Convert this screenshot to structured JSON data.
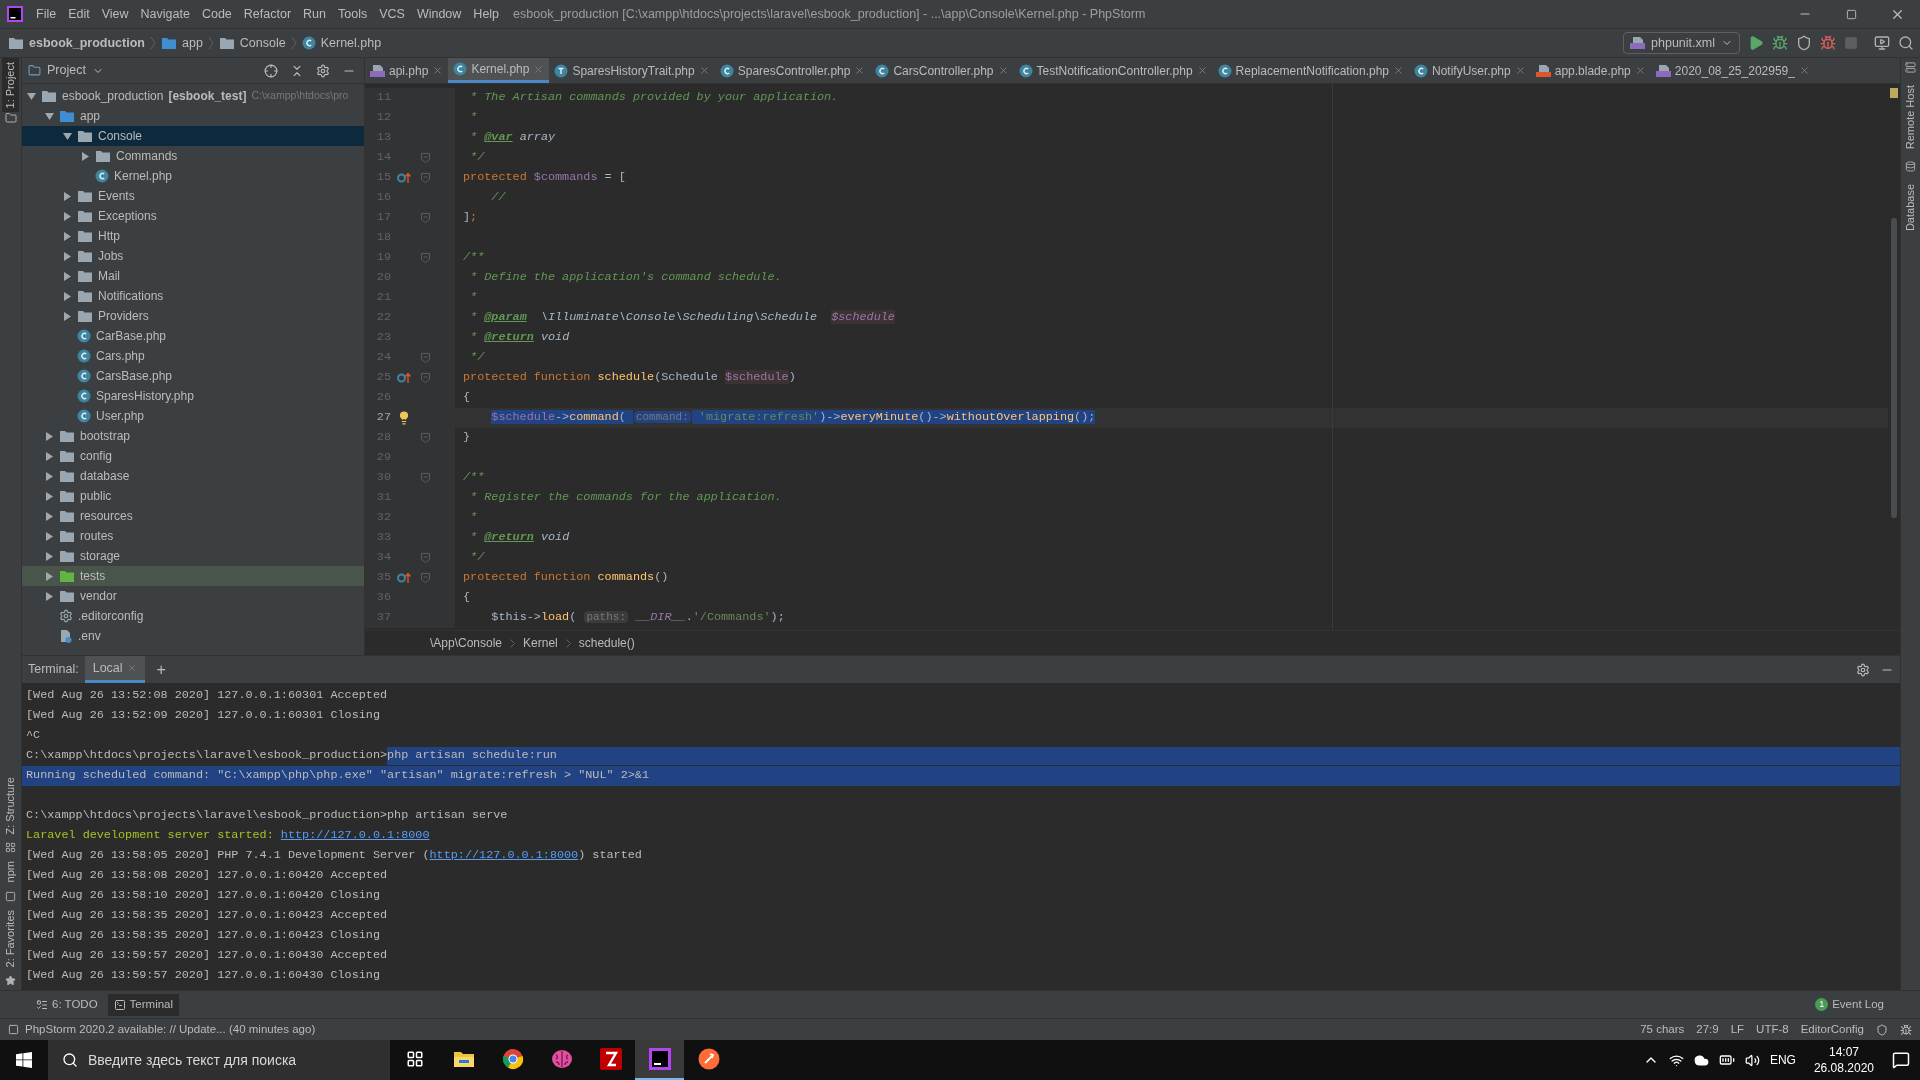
{
  "window": {
    "title": "esbook_production [C:\\xampp\\htdocs\\projects\\laravel\\esbook_production] - ...\\app\\Console\\Kernel.php - PhpStorm"
  },
  "menu": [
    "File",
    "Edit",
    "View",
    "Navigate",
    "Code",
    "Refactor",
    "Run",
    "Tools",
    "VCS",
    "Window",
    "Help"
  ],
  "nav_breadcrumb": [
    {
      "label": "esbook_production",
      "kind": "folder"
    },
    {
      "label": "app",
      "kind": "source-folder"
    },
    {
      "label": "Console",
      "kind": "folder"
    },
    {
      "label": "Kernel.php",
      "kind": "class"
    }
  ],
  "run_config": "phpunit.xml",
  "project_panel": {
    "title": "Project",
    "tree": [
      {
        "label": "esbook_production",
        "module": "[esbook_test]",
        "path": "C:\\xampp\\htdocs\\pro",
        "kind": "folder",
        "expanded": true,
        "selected": false,
        "children": [
          {
            "label": "app",
            "kind": "source-folder",
            "expanded": true,
            "selected": false,
            "children": [
              {
                "label": "Console",
                "kind": "folder",
                "expanded": true,
                "selected": true,
                "children": [
                  {
                    "label": "Commands",
                    "kind": "folder",
                    "expanded": false,
                    "selected": false
                  },
                  {
                    "label": "Kernel.php",
                    "kind": "class",
                    "selected": false
                  }
                ]
              },
              {
                "label": "Events",
                "kind": "folder",
                "expanded": false,
                "selected": false
              },
              {
                "label": "Exceptions",
                "kind": "folder",
                "expanded": false,
                "selected": false
              },
              {
                "label": "Http",
                "kind": "folder",
                "expanded": false,
                "selected": false
              },
              {
                "label": "Jobs",
                "kind": "folder",
                "expanded": false,
                "selected": false
              },
              {
                "label": "Mail",
                "kind": "folder",
                "expanded": false,
                "selected": false
              },
              {
                "label": "Notifications",
                "kind": "folder",
                "expanded": false,
                "selected": false
              },
              {
                "label": "Providers",
                "kind": "folder",
                "expanded": false,
                "selected": false
              },
              {
                "label": "CarBase.php",
                "kind": "class",
                "selected": false
              },
              {
                "label": "Cars.php",
                "kind": "class",
                "selected": false
              },
              {
                "label": "CarsBase.php",
                "kind": "class",
                "selected": false
              },
              {
                "label": "SparesHistory.php",
                "kind": "class",
                "selected": false
              },
              {
                "label": "User.php",
                "kind": "class",
                "selected": false
              }
            ]
          },
          {
            "label": "bootstrap",
            "kind": "folder",
            "expanded": false,
            "selected": false
          },
          {
            "label": "config",
            "kind": "folder",
            "expanded": false,
            "selected": false
          },
          {
            "label": "database",
            "kind": "folder",
            "expanded": false,
            "selected": false
          },
          {
            "label": "public",
            "kind": "folder",
            "expanded": false,
            "selected": false
          },
          {
            "label": "resources",
            "kind": "folder",
            "expanded": false,
            "selected": false
          },
          {
            "label": "routes",
            "kind": "folder",
            "expanded": false,
            "selected": false
          },
          {
            "label": "storage",
            "kind": "folder",
            "expanded": false,
            "selected": false
          },
          {
            "label": "tests",
            "kind": "test-folder",
            "expanded": false,
            "selected": false
          },
          {
            "label": "vendor",
            "kind": "folder",
            "expanded": false,
            "selected": false
          },
          {
            "label": ".editorconfig",
            "kind": "config",
            "selected": false
          },
          {
            "label": ".env",
            "kind": "env",
            "selected": false
          }
        ]
      }
    ]
  },
  "editor_tabs": [
    {
      "label": "api.php",
      "kind": "php",
      "selected": false
    },
    {
      "label": "Kernel.php",
      "kind": "class",
      "selected": true
    },
    {
      "label": "SparesHistoryTrait.php",
      "kind": "trait",
      "selected": false
    },
    {
      "label": "SparesController.php",
      "kind": "class",
      "selected": false
    },
    {
      "label": "CarsController.php",
      "kind": "class",
      "selected": false
    },
    {
      "label": "TestNotificationController.php",
      "kind": "class",
      "selected": false
    },
    {
      "label": "ReplacementNotification.php",
      "kind": "class",
      "selected": false
    },
    {
      "label": "NotifyUser.php",
      "kind": "class",
      "selected": false
    },
    {
      "label": "app.blade.php",
      "kind": "blade",
      "selected": false
    },
    {
      "label": "2020_08_25_202959_",
      "kind": "php",
      "selected": false
    }
  ],
  "editor": {
    "lines": [
      {
        "number": "11",
        "segments": [
          {
            "text": " * The Artisan commands provided by your application.",
            "kind": "comment"
          }
        ]
      },
      {
        "number": "12",
        "segments": [
          {
            "text": " *",
            "kind": "comment"
          }
        ]
      },
      {
        "number": "13",
        "segments": [
          {
            "text": " * ",
            "kind": "comment"
          },
          {
            "text": "@var",
            "kind": "doctag"
          },
          {
            "text": " array",
            "kind": "docval"
          }
        ]
      },
      {
        "number": "14",
        "fold": true,
        "segments": [
          {
            "text": " */",
            "kind": "comment"
          }
        ]
      },
      {
        "number": "15",
        "fold": true,
        "kind": "override",
        "segments": [
          {
            "text": "protected ",
            "kind": "keyword"
          },
          {
            "text": "$commands",
            "kind": "var"
          },
          {
            "text": " = [",
            "kind": "plain"
          }
        ]
      },
      {
        "number": "16",
        "segments": [
          {
            "text": "    //",
            "kind": "comment"
          }
        ]
      },
      {
        "number": "17",
        "fold": true,
        "segments": [
          {
            "text": "]",
            "kind": "plain"
          },
          {
            "text": ";",
            "kind": "keyword"
          }
        ]
      },
      {
        "number": "18"
      },
      {
        "number": "19",
        "fold": true,
        "segments": [
          {
            "text": "/**",
            "kind": "comment"
          }
        ]
      },
      {
        "number": "20",
        "segments": [
          {
            "text": " * Define the application's command schedule.",
            "kind": "comment"
          }
        ]
      },
      {
        "number": "21",
        "segments": [
          {
            "text": " *",
            "kind": "comment"
          }
        ]
      },
      {
        "number": "22",
        "segments": [
          {
            "text": " * ",
            "kind": "comment"
          },
          {
            "text": "@param",
            "kind": "doctag"
          },
          {
            "text": "  \\Illuminate\\Console\\Scheduling\\Schedule  ",
            "kind": "docval"
          },
          {
            "text": "$schedule",
            "kind": "docvar"
          }
        ]
      },
      {
        "number": "23",
        "segments": [
          {
            "text": " * ",
            "kind": "comment"
          },
          {
            "text": "@return",
            "kind": "doctag"
          },
          {
            "text": " void",
            "kind": "docval"
          }
        ]
      },
      {
        "number": "24",
        "fold": true,
        "segments": [
          {
            "text": " */",
            "kind": "comment"
          }
        ]
      },
      {
        "number": "25",
        "fold": true,
        "kind": "override",
        "segments": [
          {
            "text": "protected function ",
            "kind": "keyword"
          },
          {
            "text": "schedule",
            "kind": "func"
          },
          {
            "text": "(Schedule ",
            "kind": "plain"
          },
          {
            "text": "$schedule",
            "kind": "varhl"
          },
          {
            "text": ")",
            "kind": "plain"
          }
        ]
      },
      {
        "number": "26",
        "segments": [
          {
            "text": "{",
            "kind": "plain"
          }
        ]
      },
      {
        "number": "27",
        "current": true,
        "indented": true,
        "kind": "bulb",
        "segments": [
          {
            "text": "$schedule",
            "kind": "var",
            "selected": true
          },
          {
            "text": "->",
            "kind": "plain",
            "selected": true
          },
          {
            "text": "command",
            "kind": "func",
            "selected": true
          },
          {
            "text": "( ",
            "kind": "plain",
            "selected": true
          },
          {
            "text": "command:",
            "kind": "hint",
            "selected": true
          },
          {
            "text": " 'migrate:refresh'",
            "kind": "string",
            "selected": true
          },
          {
            "text": ")->",
            "kind": "plain",
            "selected": true
          },
          {
            "text": "everyMinute",
            "kind": "func",
            "selected": true
          },
          {
            "text": "()->",
            "kind": "plain",
            "selected": true
          },
          {
            "text": "withoutOverlapping",
            "kind": "func",
            "selected": true
          },
          {
            "text": "();",
            "kind": "plain",
            "selected": true
          }
        ]
      },
      {
        "number": "28",
        "fold": true,
        "segments": [
          {
            "text": "}",
            "kind": "plain"
          }
        ]
      },
      {
        "number": "29"
      },
      {
        "number": "30",
        "fold": true,
        "segments": [
          {
            "text": "/**",
            "kind": "comment"
          }
        ]
      },
      {
        "number": "31",
        "segments": [
          {
            "text": " * Register the commands for the application.",
            "kind": "comment"
          }
        ]
      },
      {
        "number": "32",
        "segments": [
          {
            "text": " *",
            "kind": "comment"
          }
        ]
      },
      {
        "number": "33",
        "segments": [
          {
            "text": " * ",
            "kind": "comment"
          },
          {
            "text": "@return",
            "kind": "doctag"
          },
          {
            "text": " void",
            "kind": "docval"
          }
        ]
      },
      {
        "number": "34",
        "fold": true,
        "segments": [
          {
            "text": " */",
            "kind": "comment"
          }
        ]
      },
      {
        "number": "35",
        "fold": true,
        "kind": "override",
        "segments": [
          {
            "text": "protected function ",
            "kind": "keyword"
          },
          {
            "text": "commands",
            "kind": "func"
          },
          {
            "text": "()",
            "kind": "plain"
          }
        ]
      },
      {
        "number": "36",
        "segments": [
          {
            "text": "{",
            "kind": "plain"
          }
        ]
      },
      {
        "number": "37",
        "segments": [
          {
            "text": "    $this->",
            "kind": "plain"
          },
          {
            "text": "load",
            "kind": "func"
          },
          {
            "text": "( ",
            "kind": "plain"
          },
          {
            "text": "paths:",
            "kind": "hint"
          },
          {
            "text": " __DIR__",
            "kind": "const"
          },
          {
            "text": ".",
            "kind": "plain"
          },
          {
            "text": "'/Commands'",
            "kind": "string"
          },
          {
            "text": ");",
            "kind": "plain"
          }
        ]
      }
    ],
    "breadcrumb": [
      "\\App\\Console",
      "Kernel",
      "schedule()"
    ]
  },
  "terminal": {
    "label": "Terminal:",
    "tabs": [
      {
        "label": "Local",
        "selected": true
      }
    ],
    "add": "+",
    "lines": [
      {
        "segments": [
          {
            "text": "[Wed Aug 26 13:52:08 2020] 127.0.0.1:60301 Accepted",
            "kind": "plain"
          }
        ]
      },
      {
        "segments": [
          {
            "text": "[Wed Aug 26 13:52:09 2020] 127.0.0.1:60301 Closing",
            "kind": "plain"
          }
        ]
      },
      {
        "segments": [
          {
            "text": "^C",
            "kind": "plain"
          }
        ]
      },
      {
        "segments": [
          {
            "text": "C:\\xampp\\htdocs\\projects\\laravel\\esbook_production>",
            "kind": "plain",
            "selected": false
          },
          {
            "text": "php artisan schedule:run",
            "kind": "plain",
            "selected": true
          }
        ]
      },
      {
        "segments": [
          {
            "text": "Running scheduled command: \"C:\\xampp\\php\\php.exe\" \"artisan\" migrate:refresh > \"NUL\" 2>&1",
            "kind": "plain",
            "selected": true
          }
        ]
      },
      {
        "spaced": true,
        "segments": [
          {
            "text": "C:\\xampp\\htdocs\\projects\\laravel\\esbook_production>php artisan serve",
            "kind": "plain"
          }
        ]
      },
      {
        "segments": [
          {
            "text": "Laravel development server started: ",
            "kind": "info"
          },
          {
            "text": "http://127.0.0.1:8000",
            "kind": "link"
          }
        ]
      },
      {
        "segments": [
          {
            "text": "[Wed Aug 26 13:58:05 2020] PHP 7.4.1 Development Server (",
            "kind": "plain"
          },
          {
            "text": "http://127.0.0.1:8000",
            "kind": "link"
          },
          {
            "text": ") started",
            "kind": "plain"
          }
        ]
      },
      {
        "segments": [
          {
            "text": "[Wed Aug 26 13:58:08 2020] 127.0.0.1:60420 Accepted",
            "kind": "plain"
          }
        ]
      },
      {
        "segments": [
          {
            "text": "[Wed Aug 26 13:58:10 2020] 127.0.0.1:60420 Closing",
            "kind": "plain"
          }
        ]
      },
      {
        "segments": [
          {
            "text": "[Wed Aug 26 13:58:35 2020] 127.0.0.1:60423 Accepted",
            "kind": "plain"
          }
        ]
      },
      {
        "segments": [
          {
            "text": "[Wed Aug 26 13:58:35 2020] 127.0.0.1:60423 Closing",
            "kind": "plain"
          }
        ]
      },
      {
        "segments": [
          {
            "text": "[Wed Aug 26 13:59:57 2020] 127.0.0.1:60430 Accepted",
            "kind": "plain"
          }
        ]
      },
      {
        "segments": [
          {
            "text": "[Wed Aug 26 13:59:57 2020] 127.0.0.1:60430 Closing",
            "kind": "plain"
          }
        ]
      }
    ]
  },
  "left_stripe": [
    "1: Project",
    "Z: Structure",
    "npm",
    "2: Favorites"
  ],
  "right_stripe": [
    "Remote Host",
    "Database"
  ],
  "tool_tabs": [
    {
      "label": "6: TODO",
      "selected": false
    },
    {
      "label": "Terminal",
      "selected": true
    }
  ],
  "event_log": {
    "count": "1",
    "label": "Event Log"
  },
  "status_bar": {
    "message": "PhpStorm 2020.2 available: // Update... (40 minutes ago)",
    "items": [
      "75 chars",
      "27:9",
      "LF",
      "UTF-8",
      "EditorConfig"
    ]
  },
  "taskbar": {
    "search_placeholder": "Введите здесь текст для поиска",
    "apps": [
      {
        "kind": "task-view",
        "selected": false
      },
      {
        "kind": "explorer",
        "selected": false
      },
      {
        "kind": "chrome",
        "selected": false
      },
      {
        "kind": "brain",
        "selected": false
      },
      {
        "kind": "filezilla",
        "selected": false
      },
      {
        "kind": "phpstorm",
        "selected": true
      },
      {
        "kind": "postman",
        "selected": false
      }
    ],
    "language": "ENG",
    "time": "14:07",
    "date": "26.08.2020"
  }
}
